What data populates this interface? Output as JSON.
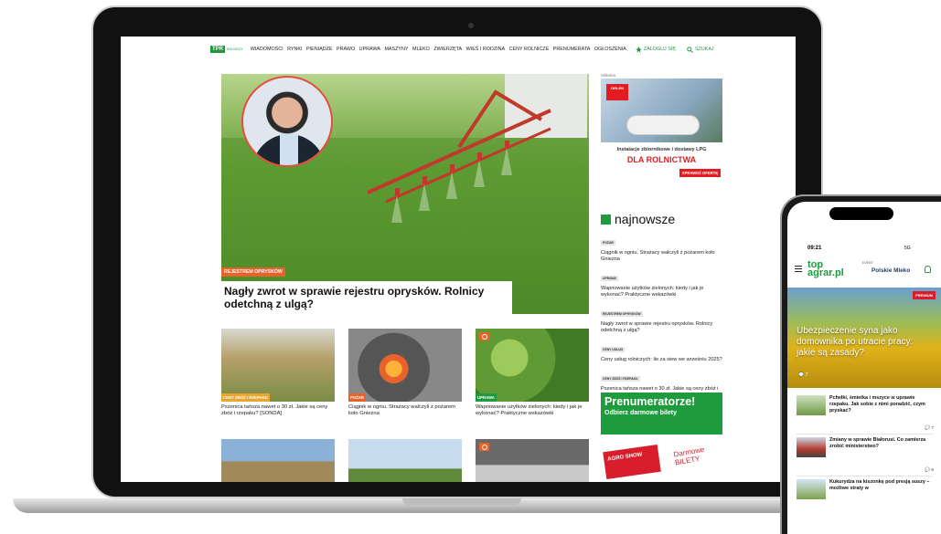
{
  "nav": {
    "logo": "TPR",
    "logo_sub": "ROLNICZY",
    "items": [
      "WIADOMOŚCI",
      "RYNKI",
      "PIENIĄDZE",
      "PRAWO",
      "UPRAWA",
      "MASZYNY",
      "MLEKO",
      "ZWIERZĘTA",
      "WIEŚ I RODZINA",
      "CENY ROLNICZE",
      "PRENUMERATA",
      "OGŁOSZENIA"
    ],
    "login": "ZALOGUJ SIĘ",
    "search": "SZUKAJ"
  },
  "hero": {
    "tag": "REJESTREM OPRYSKÓW",
    "title": "Nagły zwrot w sprawie rejestru oprysków. Rolnicy odetchną z ulgą?"
  },
  "cards": [
    {
      "tag": "CENY ZBÓŻ I RZEPAKU",
      "caption": "Pszenica tańsza nawet o 30 zł. Jakie są ceny zbóż i rzepaku? [SONDA]",
      "color": "#e8a62c"
    },
    {
      "tag": "POŻAR",
      "caption": "Ciągnik w ogniu. Strażacy walczyli z pożarem koło Gniezna",
      "color": "#e8622c"
    },
    {
      "tag": "UPRAWA",
      "caption": "Wapnowanie użytków zielonych: kiedy i jak je wykonać? Praktyczne wskazówki",
      "color": "#1e9b3c"
    }
  ],
  "ad1": {
    "label": "reklama",
    "brand": "ORLEN",
    "line1": "Instalacje zbiornikowe i dostawy LPG",
    "line2": "DLA ROLNICTWA",
    "cta": "SPRAWDŹ OFERTĘ"
  },
  "najnowsze": {
    "heading": "najnowsze",
    "items": [
      {
        "tag": "POŻAR",
        "text": "Ciągnik w ogniu. Strażacy walczyli z pożarem koło Gniezna"
      },
      {
        "tag": "UPRAWA",
        "text": "Wapnowanie użytków zielonych: kiedy i jak je wykonać? Praktyczne wskazówki"
      },
      {
        "tag": "REJESTREM OPRYSKÓW",
        "text": "Nagły zwrot w sprawie rejestru oprysków. Rolnicy odetchną z ulgą?"
      },
      {
        "tag": "CENY USŁUG",
        "text": "Ceny usług rolniczych: ile za siew we wrześniu 2025?"
      },
      {
        "tag": "CENY ZBÓŻ I RZEPAKU",
        "text": "Pszenica tańsza nawet o 30 zł. Jakie są ceny zbóż i rzepaku? [SONDA]"
      }
    ]
  },
  "prenum": {
    "title": "Prenumeratorze!",
    "subtitle": "Odbierz darmowe bilety"
  },
  "ad2": {
    "ticket": "AGRO SHOW",
    "text": "Darmowe BILETY"
  },
  "phone": {
    "time": "09:21",
    "signal": "5G",
    "logo_top": "top",
    "logo_bottom": "agrar.pl",
    "event": "EVENT",
    "event_name": "Polskie Mleko",
    "premium": "PREMIUM",
    "hero_title": "Ubezpieczenie syna jako domownika po utracie pracy: jakie są zasady?",
    "hero_count": "7",
    "items": [
      {
        "text": "Pchełki, śmietka i mszyce w uprawie rzepaku. Jak sobie z nimi poradzić, czym pryskać?",
        "count": "7"
      },
      {
        "text": "Zmiany w sprawie Białorusi. Co zamierza zrobić ministerstwo?",
        "count": "6"
      },
      {
        "text": "Kukurydza na kiszonkę pod presją suszy – możliwe straty w",
        "count": ""
      }
    ]
  }
}
